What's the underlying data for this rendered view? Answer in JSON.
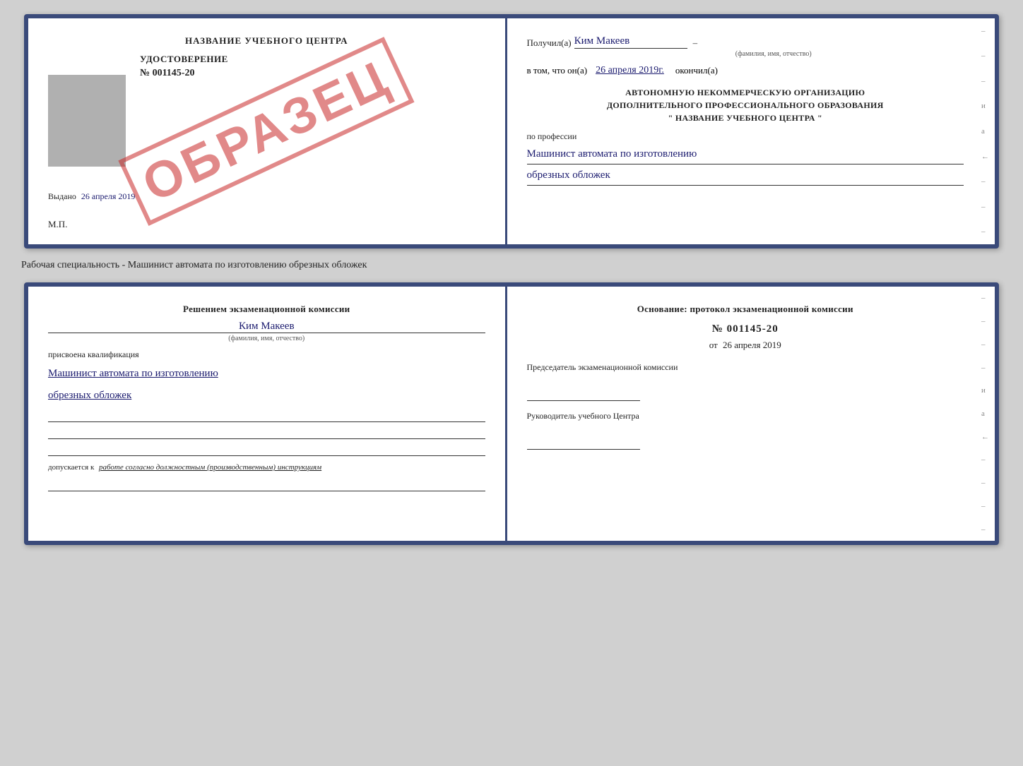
{
  "topDoc": {
    "left": {
      "title": "НАЗВАНИЕ УЧЕБНОГО ЦЕНТРА",
      "watermark": "ОБРАЗЕЦ",
      "udostoverenie": "УДОСТОВЕРЕНИЕ",
      "number": "№ 001145-20",
      "vydano_label": "Выдано",
      "vydano_date": "26 апреля 2019",
      "mp": "М.П."
    },
    "right": {
      "poluchil_label": "Получил(а)",
      "poluchil_name": "Ким Макеев",
      "fio_sublabel": "(фамилия, имя, отчество)",
      "v_tom_label": "в том, что он(а)",
      "v_tom_date": "26 апреля 2019г.",
      "okonchil_label": "окончил(а)",
      "org_line1": "АВТОНОМНУЮ НЕКОММЕРЧЕСКУЮ ОРГАНИЗАЦИЮ",
      "org_line2": "ДОПОЛНИТЕЛЬНОГО ПРОФЕССИОНАЛЬНОГО ОБРАЗОВАНИЯ",
      "org_line3": "\"  НАЗВАНИЕ УЧЕБНОГО ЦЕНТРА  \"",
      "po_professii": "по профессии",
      "profession_line1": "Машинист автомата по изготовлению",
      "profession_line2": "обрезных обложек",
      "right_marks": [
        "–",
        "–",
        "–",
        "и",
        "а",
        "←",
        "–",
        "–",
        "–"
      ]
    }
  },
  "separatorText": "Рабочая специальность - Машинист автомата по изготовлению обрезных обложек",
  "bottomDoc": {
    "left": {
      "resheniem": "Решением экзаменационной комиссии",
      "person_name": "Ким Макеев",
      "fio_sublabel": "(фамилия, имя, отчество)",
      "prisvoena": "присвоена квалификация",
      "qualification_line1": "Машинист автомата по изготовлению",
      "qualification_line2": "обрезных обложек",
      "dopuskaetsya_prefix": "допускается к",
      "dopuskaetsya_text": "работе согласно должностным (производственным) инструкциям"
    },
    "right": {
      "osnovanie": "Основание: протокол экзаменационной комиссии",
      "protocol_number": "№  001145-20",
      "ot_label": "от",
      "ot_date": "26 апреля 2019",
      "predsedatel_label": "Председатель экзаменационной комиссии",
      "rukovoditel_label": "Руководитель учебного Центра",
      "right_marks": [
        "–",
        "–",
        "–",
        "–",
        "и",
        "а",
        "←",
        "–",
        "–",
        "–",
        "–"
      ]
    }
  }
}
